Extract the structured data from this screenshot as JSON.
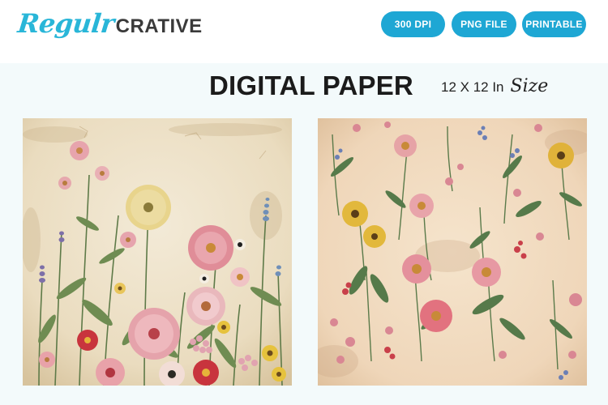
{
  "brand": {
    "script": "Regulr",
    "sans": "CRATIVE",
    "script_color": "#29b6d8",
    "sans_color": "#3a3a3a"
  },
  "badges": [
    {
      "label": "300 DPI"
    },
    {
      "label": "PNG FILE"
    },
    {
      "label": "PRINTABLE"
    }
  ],
  "badge_color": "#1ea7d4",
  "headline": "DIGITAL PAPER",
  "size": {
    "dimension": "12 X 12 In",
    "word": "Size"
  },
  "previews": [
    {
      "name": "wildflower-meadow-paper",
      "background": "#efe3cc"
    },
    {
      "name": "scattered-wildflower-pattern-paper",
      "background": "#f2dcc2"
    }
  ]
}
